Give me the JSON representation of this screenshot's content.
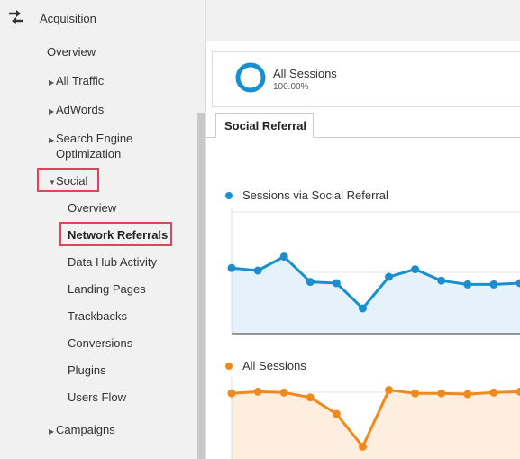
{
  "sidebar": {
    "section_title": "Acquisition",
    "section_icon": "acquisition-arrows-icon",
    "items": [
      {
        "label": "Overview"
      },
      {
        "label": "All Traffic",
        "arrow": "▶"
      },
      {
        "label": "AdWords",
        "arrow": "▶"
      },
      {
        "label": "Search Engine",
        "label2": "Optimization",
        "arrow": "▶"
      },
      {
        "label": "Social",
        "arrow": "▼"
      },
      {
        "label": "Campaigns",
        "arrow": "▶"
      }
    ],
    "social_items": [
      {
        "label": "Overview"
      },
      {
        "label": "Network Referrals"
      },
      {
        "label": "Data Hub Activity"
      },
      {
        "label": "Landing Pages"
      },
      {
        "label": "Trackbacks"
      },
      {
        "label": "Conversions"
      },
      {
        "label": "Plugins"
      },
      {
        "label": "Users Flow"
      }
    ],
    "highlight_color": "#e0435c"
  },
  "segment": {
    "title": "All Sessions",
    "percent": "100.00%",
    "ring_color": "#1a8fd0"
  },
  "tab": {
    "label": "Social Referral"
  },
  "chart_data": [
    {
      "type": "line",
      "legend": "Sessions via Social Referral",
      "color": "#1a8fd0",
      "fill": "#e5f2f9",
      "x": [
        1,
        2,
        3,
        4,
        5,
        6,
        7,
        8,
        9,
        10,
        11,
        12
      ],
      "values": [
        52,
        50,
        61,
        41,
        40,
        20,
        45,
        51,
        42,
        39,
        39,
        40
      ],
      "ylim": [
        0,
        100
      ]
    },
    {
      "type": "area",
      "legend": "All Sessions",
      "color": "#f08a1d",
      "fill": "#fdeee0",
      "x": [
        1,
        2,
        3,
        4,
        5,
        6,
        7,
        8,
        9,
        10,
        11,
        12
      ],
      "values": [
        80,
        82,
        81,
        75,
        55,
        15,
        84,
        80,
        80,
        79,
        81,
        82
      ],
      "ylim": [
        0,
        100
      ]
    }
  ]
}
